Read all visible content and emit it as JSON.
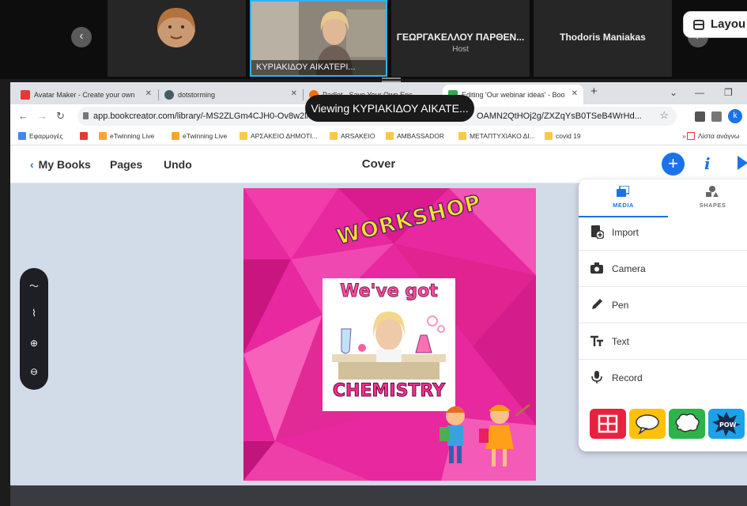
{
  "zoom": {
    "tiles": [
      {
        "name": "",
        "sub": ""
      },
      {
        "name": "ΚΥΡΙΑΚΙΔΟΥ ΑΙΚΑΤΕΡΙ...",
        "sub": ""
      },
      {
        "name": "ΓΕΩΡΓΑΚΕΛΛΟΥ ΠΑΡΘΕΝ...",
        "sub": "Host"
      },
      {
        "name": "Thodoris Maniakas",
        "sub": ""
      }
    ],
    "layout_label": "Layou",
    "viewing_banner": "Viewing ΚΥΡΙΑΚΙΔΟΥ ΑΙΚΑΤΕ..."
  },
  "browser": {
    "tabs": [
      {
        "label": "Avatar Maker - Create your own",
        "color": "#e53935"
      },
      {
        "label": "dotstorming",
        "color": "#455a64"
      },
      {
        "label": "Padlet - Save Your Own Enc",
        "color": "#ff6d00"
      },
      {
        "label": "Editing 'Our webinar ideas' - Boo",
        "color": "#34a853"
      }
    ],
    "url_left": "app.bookcreator.com/library/-MS2ZLGm4CJH0-Ov8w2l/sz",
    "url_right": "OAMN2QtHOj2g/ZXZqYsB0TSeB4WrHd...",
    "profile_initial": "k",
    "bookmarks": [
      {
        "label": "Εφαρμογές",
        "color": "#4285f4"
      },
      {
        "label": "",
        "color": "#e53935"
      },
      {
        "label": "eTwinning Live",
        "color": "#f9a825"
      },
      {
        "label": "eTwinning Live",
        "color": "#f9a825"
      },
      {
        "label": "ΑΡΣΑΚΕΙΟ ΔΗΜΟΤΙ...",
        "color": "#f7c948"
      },
      {
        "label": "ARSAKEIO",
        "color": "#f7c948"
      },
      {
        "label": "AMBASSADOR",
        "color": "#f7c948"
      },
      {
        "label": "ΜΕΤΑΠΤΥΧΙΑΚΟ ΔΙ...",
        "color": "#f7c948"
      },
      {
        "label": "covid 19",
        "color": "#f7c948"
      },
      {
        "label": "Λίστα ανάγνω",
        "color": "#e53935"
      }
    ]
  },
  "app": {
    "back_label": "My Books",
    "pages_label": "Pages",
    "undo_label": "Undo",
    "title": "Cover",
    "plus_label": "+",
    "info_label": "i"
  },
  "cover": {
    "workshop_text": "WORKSHOP",
    "card_top_text": "We've got",
    "card_bottom_text": "CHEMISTRY",
    "bg_color": "#e7289f"
  },
  "panel": {
    "tabs": [
      {
        "label": "MEDIA"
      },
      {
        "label": "SHAPES"
      }
    ],
    "items": [
      {
        "label": "Import",
        "icon": "import-icon"
      },
      {
        "label": "Camera",
        "icon": "camera-icon"
      },
      {
        "label": "Pen",
        "icon": "pen-icon"
      },
      {
        "label": "Text",
        "icon": "text-icon"
      },
      {
        "label": "Record",
        "icon": "microphone-icon"
      }
    ],
    "swatch_colors": [
      "#e8213f",
      "#ffc107",
      "#2db34a",
      "#1aa3e8"
    ]
  }
}
